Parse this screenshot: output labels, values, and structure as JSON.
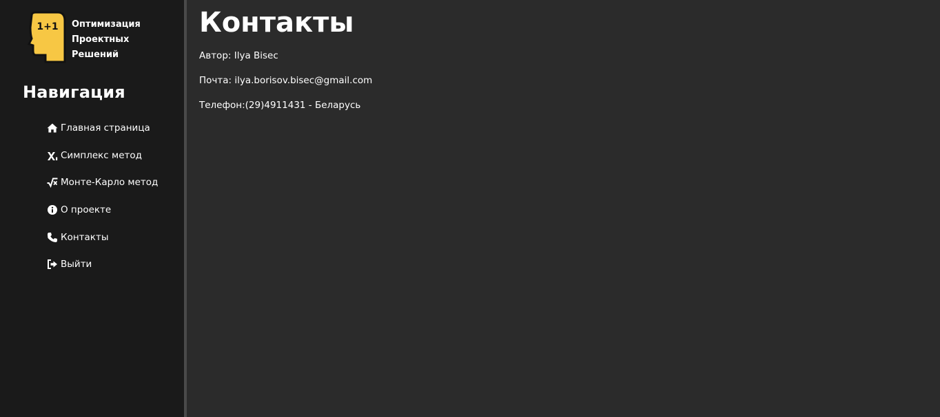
{
  "brand": {
    "logo_text": "1+1",
    "line1": "Оптимизация",
    "line2": "Проектных",
    "line3": "Решений"
  },
  "nav": {
    "title": "Навигация",
    "items": [
      {
        "label": "Главная страница",
        "icon": "home-icon"
      },
      {
        "label": "Симплекс метод",
        "icon": "subscript-x-icon"
      },
      {
        "label": "Монте-Карло метод",
        "icon": "square-root-icon"
      },
      {
        "label": "О проекте",
        "icon": "info-circle-icon"
      },
      {
        "label": "Контакты",
        "icon": "phone-icon"
      },
      {
        "label": "Выйти",
        "icon": "sign-out-icon"
      }
    ]
  },
  "main": {
    "title": "Контакты",
    "author": "Автор: Ilya Bisec",
    "email": "Почта: ilya.borisov.bisec@gmail.com",
    "phone": "Телефон:(29)4911431 - Беларусь"
  },
  "colors": {
    "sidebar_bg": "#1a1a1a",
    "main_bg": "#2b2b2b",
    "logo_yellow": "#f7c744",
    "text": "#ffffff"
  }
}
